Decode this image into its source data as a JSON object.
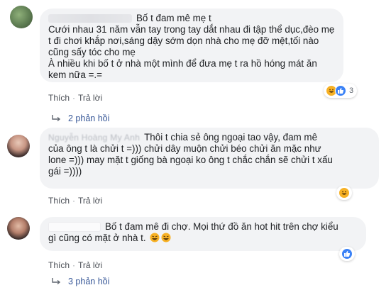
{
  "comments": [
    {
      "author": "Bố t đam mê mẹ t",
      "lines": [
        "Cưới nhau 31 năm vẫn tay trong tay dắt nhau đi tập thể dục,đèo mẹ",
        "t đi chơi khắp nơi,sáng dậy sớm dọn nhà cho mẹ đỡ mệt,tối nào",
        "cũng sấy tóc cho mẹ",
        "À nhiều khi bố t ở nhà một mình để đưa mẹ t ra hồ hóng mát ăn",
        "kem nữa =.="
      ],
      "actions": [
        "Thích",
        "Trả lời"
      ],
      "reaction_count": "3",
      "reaction_icons": [
        "haha-icon",
        "like-icon"
      ],
      "replies_label": "2 phản hồi"
    },
    {
      "author_blurred": "Nguyễn Hoàng My Anh",
      "lines": [
        "Thôi t chia sẻ ông ngoại tao vậy, đam mê",
        "của ông t là chửi t =))) chửi dây muộn chửi béo chửi ăn mặc như",
        "lone =))) may mặt t giống bà ngoại ko ông t chắc chắn sẽ chửi t xấu",
        "gái =))))"
      ],
      "actions": [
        "Thích",
        "Trả lời"
      ],
      "reaction_count": "",
      "reaction_icons": [
        "haha-icon"
      ]
    },
    {
      "lines": [
        "Bố t đam mê đi chợ. Mọi thứ đồ ăn hot hit trên chợ kiểu",
        "gì cũng có mặt ở nhà t."
      ],
      "actions": [
        "Thích",
        "Trả lời"
      ],
      "reaction_count": "",
      "reaction_icons": [
        "like-icon"
      ],
      "replies_label": "3 phản hồi"
    }
  ],
  "colors": {
    "bubble": "#f2f3f5",
    "link": "#385898",
    "meta": "#606770",
    "like": "#3b82f6",
    "haha": "#f7b125"
  }
}
